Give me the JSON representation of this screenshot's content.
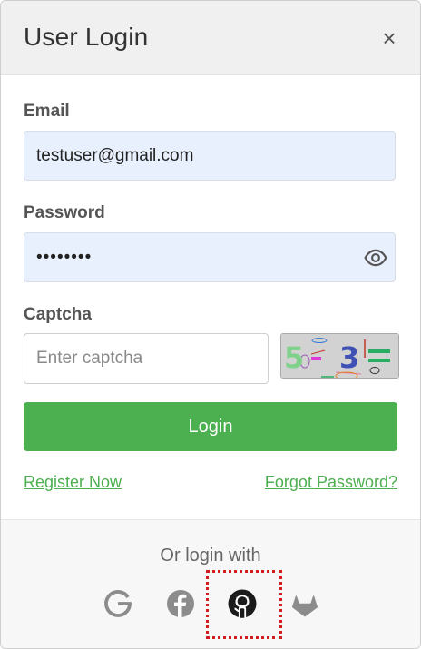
{
  "dialog": {
    "title": "User Login",
    "close_symbol": "×"
  },
  "form": {
    "email_label": "Email",
    "email_value": "testuser@gmail.com",
    "password_label": "Password",
    "password_value": "password",
    "captcha_label": "Captcha",
    "captcha_placeholder": "Enter captcha",
    "captcha_text": "5 - 3 =",
    "login_button": "Login"
  },
  "links": {
    "register": "Register Now",
    "forgot": "Forgot Password?"
  },
  "footer": {
    "or_text": "Or login with",
    "providers": [
      "google-icon",
      "facebook-icon",
      "github-icon",
      "gitlab-icon"
    ]
  },
  "colors": {
    "accent": "#4caf50",
    "autofill_bg": "#e8f0fe",
    "focus_outline": "#d01d1d"
  }
}
